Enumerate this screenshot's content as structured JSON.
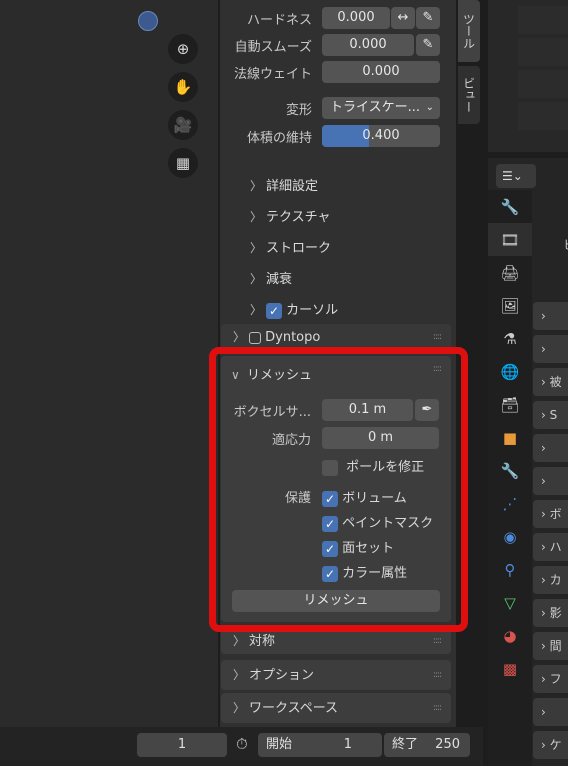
{
  "brush": {
    "hardness_label": "ハードネス",
    "hardness_value": "0.000",
    "autosmooth_label": "自動スムーズ",
    "autosmooth_value": "0.000",
    "normal_weight_label": "法線ウェイト",
    "normal_weight_value": "0.000",
    "deform_label": "変形",
    "deform_value": "トライスケー...",
    "preserve_volume_label": "体積の維持",
    "preserve_volume_value": "0.400",
    "preserve_volume_fraction": 0.4
  },
  "subsections": [
    "詳細設定",
    "テクスチャ",
    "ストローク",
    "減衰"
  ],
  "cursor_label": "カーソル",
  "dyntopo_label": "Dyntopo",
  "remesh": {
    "title": "リメッシュ",
    "voxel_size_label": "ボクセルサ...",
    "voxel_size_value": "0.1 m",
    "adaptivity_label": "適応力",
    "adaptivity_value": "0 m",
    "fix_poles_label": "ポールを修正",
    "preserve_label": "保護",
    "options": [
      "ボリューム",
      "ペイントマスク",
      "面セット",
      "カラー属性"
    ],
    "button_label": "リメッシュ"
  },
  "sections": [
    "対称",
    "オプション",
    "ワークスペース"
  ],
  "side_tabs": [
    "ツール",
    "ビュー"
  ],
  "timeline": {
    "current_frame": "1",
    "start_label": "開始",
    "start_value": "1",
    "end_label": "終了",
    "end_value": "250"
  },
  "properties_rows": [
    "",
    "",
    "被",
    "S",
    "",
    "",
    "ボ",
    "ハ",
    "カ",
    "影",
    "間",
    "フ",
    "",
    "ケ"
  ],
  "properties_header_char": "ヒ",
  "colors": {
    "highlight": "#e00f0f",
    "checkbox": "#4772b3",
    "slider_fill": "#4772b3"
  }
}
